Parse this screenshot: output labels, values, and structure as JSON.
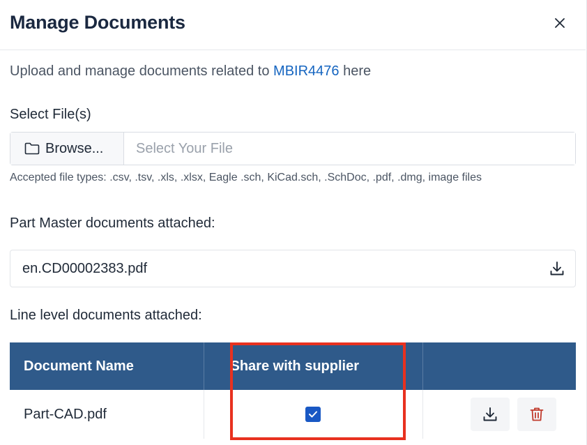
{
  "modal": {
    "title": "Manage Documents",
    "close_icon": "close-icon"
  },
  "intro": {
    "prefix": "Upload and manage documents related to ",
    "reference": "MBIR4476",
    "suffix": " here"
  },
  "upload": {
    "label": "Select File(s)",
    "browse_label": "Browse...",
    "browse_icon": "folder-icon",
    "placeholder": "Select Your File",
    "value": "",
    "accepted_types": "Accepted file types: .csv, .tsv, .xls, .xlsx, Eagle .sch, KiCad.sch, .SchDoc, .pdf, .dmg, image files"
  },
  "part_master": {
    "label": "Part Master documents attached:",
    "documents": [
      {
        "name": "en.CD00002383.pdf",
        "icon": "download-icon"
      }
    ]
  },
  "line_level": {
    "label": "Line level documents attached:",
    "columns": [
      "Document Name",
      "Share with supplier",
      ""
    ],
    "rows": [
      {
        "name": "Part-CAD.pdf",
        "share_with_supplier": true,
        "actions": [
          "download-icon",
          "trash-icon"
        ]
      }
    ]
  },
  "colors": {
    "header_bg": "#2f5a8a",
    "link": "#1565c0",
    "checkbox": "#1958c4",
    "highlight": "#e8311f",
    "delete": "#c0392b"
  }
}
